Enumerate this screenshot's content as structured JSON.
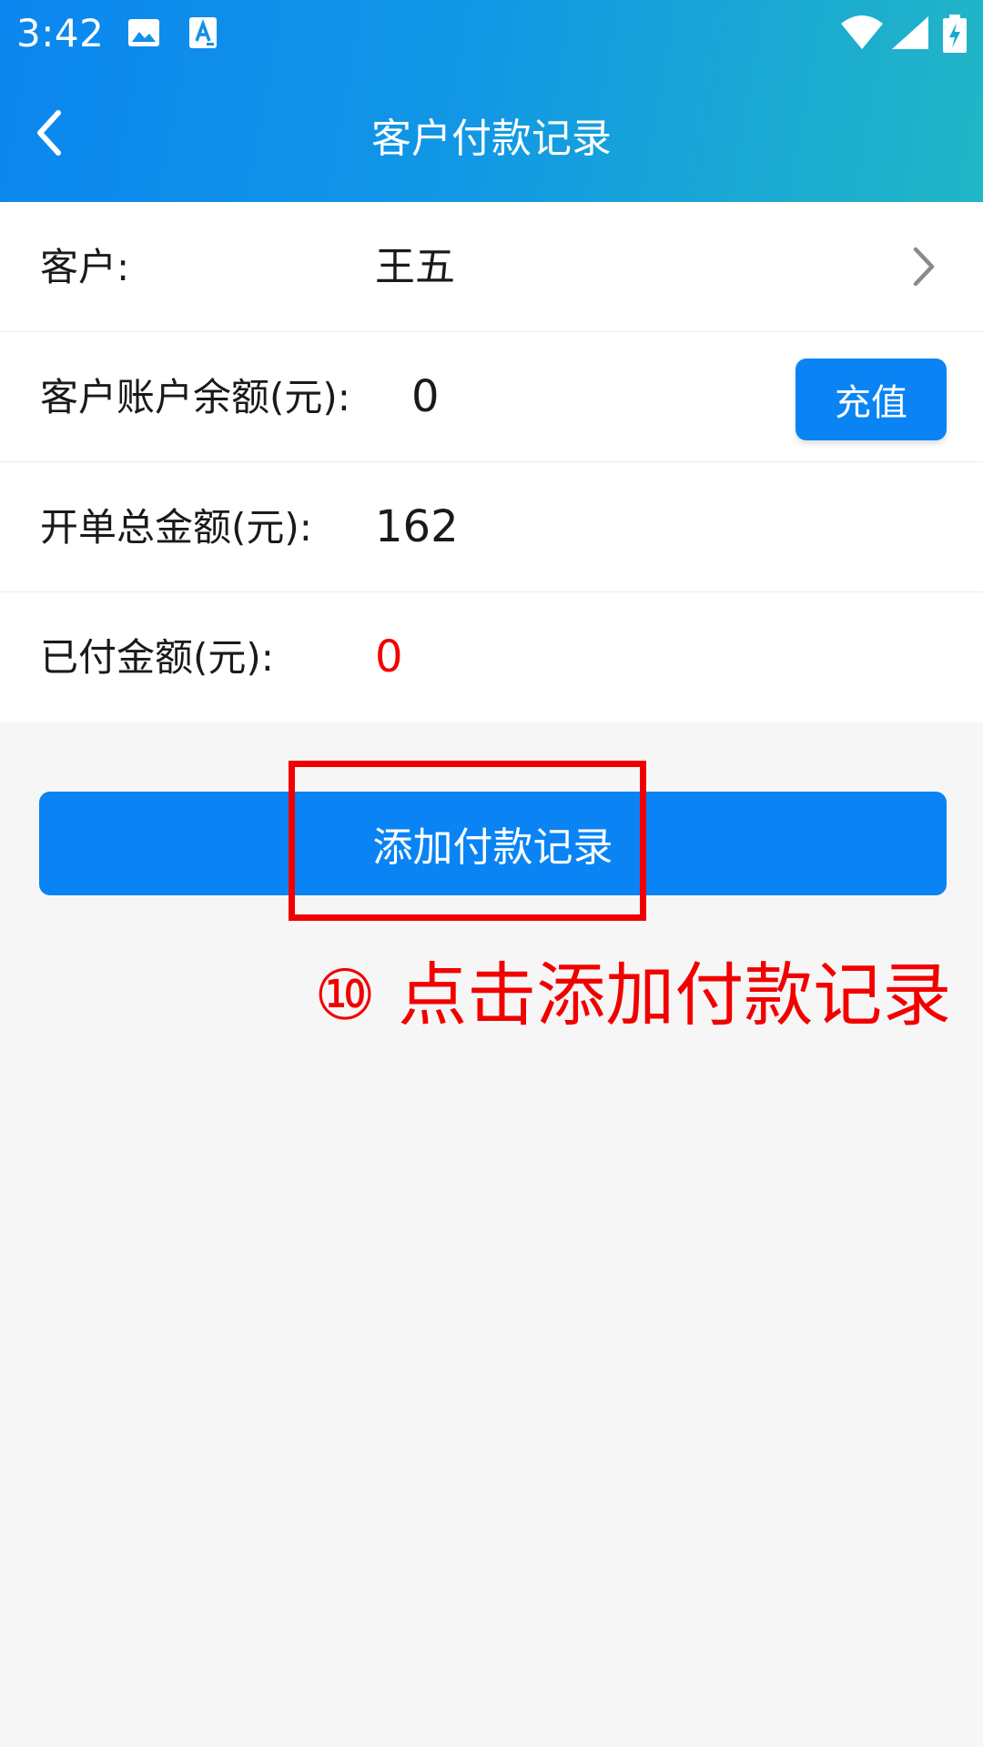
{
  "status_bar": {
    "time": "3:42",
    "icons": [
      "image-icon",
      "font-a-icon",
      "wifi-icon",
      "signal-icon",
      "battery-charging-icon"
    ]
  },
  "nav": {
    "back_icon": "chevron-left-icon",
    "title": "客户付款记录"
  },
  "form": {
    "customer": {
      "label": "客户:",
      "value": "王五",
      "chevron_icon": "chevron-right-icon"
    },
    "balance": {
      "label": "客户账户余额(元):",
      "value": "0",
      "button_label": "充值"
    },
    "total": {
      "label": "开单总金额(元):",
      "value": "162"
    },
    "paid": {
      "label": "已付金额(元):",
      "value": "0",
      "value_color": "#f20000"
    }
  },
  "actions": {
    "add_payment_label": "添加付款记录"
  },
  "annotation": {
    "text": "⑩ 点击添加付款记录",
    "color": "#f20000"
  },
  "colors": {
    "primary": "#0a84f4",
    "header_gradient_start": "#0b86ef",
    "header_gradient_end": "#21b6c6",
    "background": "#f6f6f6"
  }
}
